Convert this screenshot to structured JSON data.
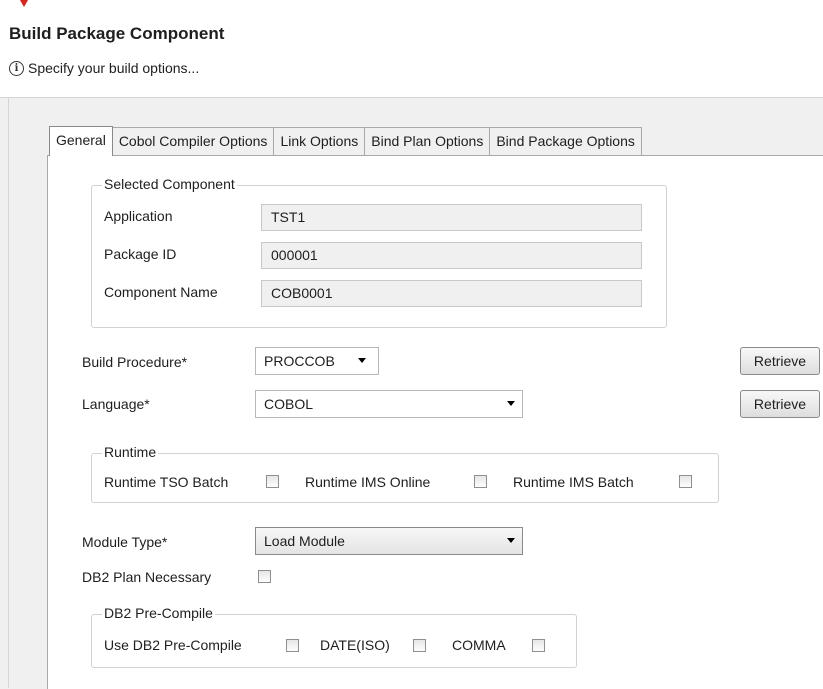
{
  "dialog": {
    "title": "Build Package Component",
    "subtitle": "Specify your build options...",
    "info_icon": "i"
  },
  "tabs": [
    {
      "label": "General",
      "active": true
    },
    {
      "label": "Cobol Compiler Options",
      "active": false
    },
    {
      "label": "Link Options",
      "active": false
    },
    {
      "label": "Bind Plan Options",
      "active": false
    },
    {
      "label": "Bind Package Options",
      "active": false
    }
  ],
  "selected_component": {
    "title": "Selected Component",
    "application_label": "Application",
    "application_value": "TST1",
    "package_id_label": "Package ID",
    "package_id_value": "000001",
    "component_name_label": "Component Name",
    "component_name_value": "COB0001"
  },
  "build_procedure": {
    "label": "Build Procedure*",
    "value": "PROCCOB",
    "retrieve": "Retrieve"
  },
  "language": {
    "label": "Language*",
    "value": "COBOL",
    "retrieve": "Retrieve"
  },
  "runtime": {
    "title": "Runtime",
    "tso_batch": "Runtime TSO Batch",
    "ims_online": "Runtime IMS Online",
    "ims_batch": "Runtime IMS Batch"
  },
  "module_type": {
    "label": "Module Type*",
    "value": "Load Module"
  },
  "db2_plan": {
    "label": "DB2 Plan Necessary"
  },
  "db2_precompile": {
    "title": "DB2 Pre-Compile",
    "use": "Use DB2 Pre-Compile",
    "date_iso": "DATE(ISO)",
    "comma": "COMMA"
  },
  "colors": {
    "accent": "#d9231c",
    "panel": "#ffffff",
    "background": "#f0f0f0"
  }
}
